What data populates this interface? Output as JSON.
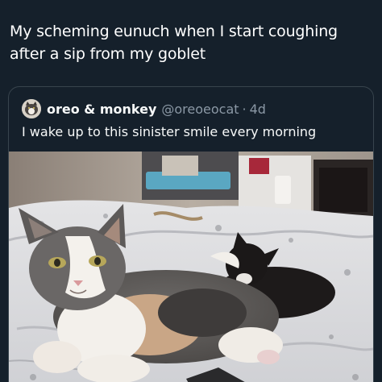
{
  "post": {
    "caption": "My scheming eunuch when I start coughing after a sip from my goblet"
  },
  "quote": {
    "display_name": "oreo & monkey",
    "handle": "@oreoeocat",
    "separator": "·",
    "time": "4d",
    "text": "I wake up to this sinister smile every morning",
    "avatar_icon": "cat-avatar-icon",
    "media_subject": "calico-cat-and-black-kitten-on-bed"
  },
  "colors": {
    "background": "#15202b",
    "border": "#38444d",
    "secondary_text": "#8b98a5"
  }
}
